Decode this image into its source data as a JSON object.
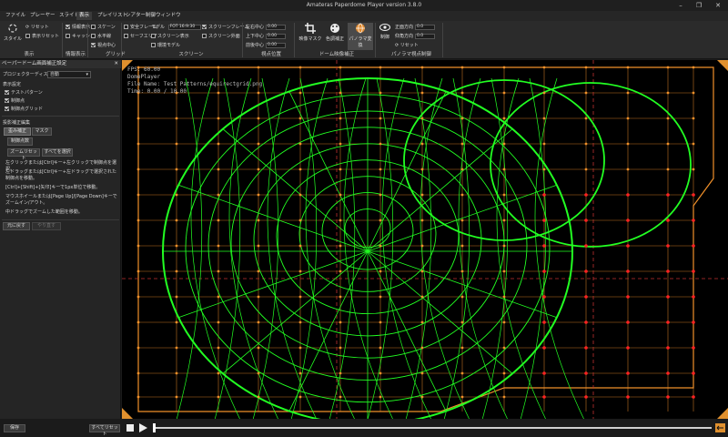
{
  "window": {
    "title": "Amateras Paperdome Player version 3.8.0"
  },
  "menu": [
    "ファイル",
    "プレーヤー",
    "スライド",
    "表示",
    "プレイリスト",
    "シアター制御",
    "ウィンドウ"
  ],
  "ribbon": {
    "style": {
      "label": "スタイル",
      "reset": "リセット",
      "display_reset": "表示リセット",
      "group": "表示"
    },
    "info": {
      "items": [
        "情報表示",
        "キャッシュ"
      ],
      "group": "情報表示"
    },
    "grid": {
      "items": [
        "スケーン",
        "水平線",
        "視点中心"
      ],
      "group": "グリッド"
    },
    "screen": {
      "items": [
        "安全フレーム",
        "セーフエリア",
        "スクリーン表示",
        "環境モデル",
        "スクリーン外面",
        "スクリーンフレーム"
      ],
      "model_label": "モデル",
      "model_value": "FOT 16:9:30",
      "group": "スクリーン"
    },
    "view_pos": {
      "items": [
        {
          "label": "左右中心",
          "value": "0.00"
        },
        {
          "label": "上下中心",
          "value": "0.00"
        },
        {
          "label": "前後中心",
          "value": "0.00"
        }
      ],
      "group": "視点位置"
    },
    "dome": {
      "buttons": [
        "映像マスク",
        "色調補正",
        "パノラマ変換"
      ],
      "group": "ドーム映像補正"
    },
    "panorama": {
      "control": "制御",
      "items": [
        {
          "label": "正面方向",
          "value": "0.0"
        },
        {
          "label": "仰角方向",
          "value": "0.0"
        }
      ],
      "reset": "リセット",
      "group": "パノラマ視点制御"
    }
  },
  "panel": {
    "title": "ペーパードーム画面補正設定",
    "projector_label": "プロジェクターディスプレイ",
    "projector_value": "自動",
    "display_settings": "表示設定",
    "checks": [
      "テストパターン",
      "制御点",
      "制御点グリッド"
    ],
    "edit_title": "投影補正編集",
    "tabs": [
      "歪み補正",
      "マスク"
    ],
    "control_point": "制御点数",
    "buttons_row": [
      "ズームリセット",
      "すべてを選択"
    ],
    "help": [
      "左クリックまたは[Ctrl]キー+左クリックで制御点を選択。",
      "左ドラッグまたは[Ctrl]キー+左ドラッグで選択された制御点を移動。",
      "[Ctrl]+[Shift]+[矢印]キーで1px単位で移動。",
      "マウスホイールまたは[Page Up]/[Page Down]キーでズームイン/アウト。",
      "中ドラッグでズームした範囲を移動。"
    ],
    "undo": "元に戻す",
    "redo": "やり直す",
    "save": "保存",
    "reset_all": "すべてリセット"
  },
  "overlay": {
    "fps": "FPS: 60.00",
    "player": "DomePlayer",
    "file": "File Name: Test Patterns/equirectgrid.png",
    "time": "Time: 0.00 / 10.00"
  },
  "colors": {
    "accent": "#f0902a",
    "grid_green": "#22ff22",
    "control_red": "#ff2222"
  },
  "playback": {
    "progress": 0.0
  }
}
